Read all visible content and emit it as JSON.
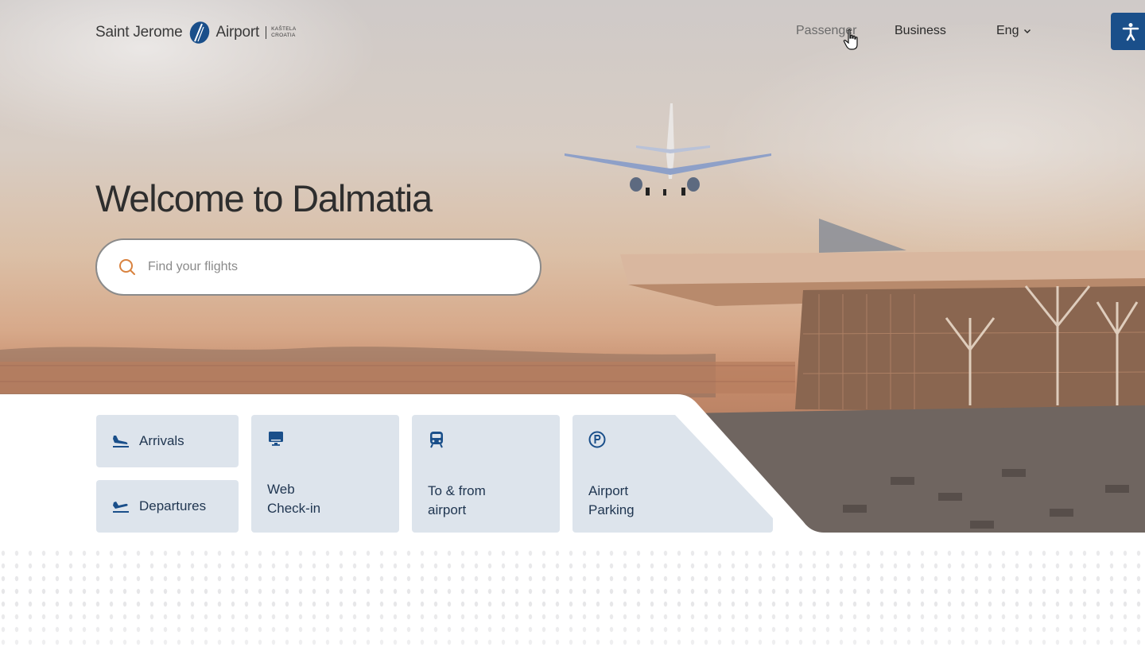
{
  "header": {
    "logo": {
      "left_text": "Saint Jerome",
      "right_text": "Airport",
      "sub_line1": "KAŠTELA",
      "sub_line2": "CROATIA"
    },
    "nav": {
      "passenger": "Passenger",
      "business": "Business",
      "language": "Eng"
    },
    "accessibility_icon": "accessibility-icon"
  },
  "hero": {
    "title": "Welcome to Dalmatia",
    "search": {
      "placeholder": "Find your flights",
      "value": ""
    }
  },
  "quick_links": {
    "arrivals": {
      "label": "Arrivals",
      "icon": "plane-landing-icon"
    },
    "departures": {
      "label": "Departures",
      "icon": "plane-takeoff-icon"
    },
    "web_checkin": {
      "line1": "Web",
      "line2": "Check-in",
      "icon": "monitor-icon"
    },
    "transport": {
      "line1": "To & from",
      "line2": "airport",
      "icon": "bus-icon"
    },
    "parking": {
      "line1": "Airport",
      "line2": "Parking",
      "icon": "parking-icon"
    }
  },
  "colors": {
    "brand_blue": "#1a4f8a",
    "card_bg": "#dde4ec",
    "card_text": "#1f3550",
    "search_icon": "#d9823f"
  }
}
